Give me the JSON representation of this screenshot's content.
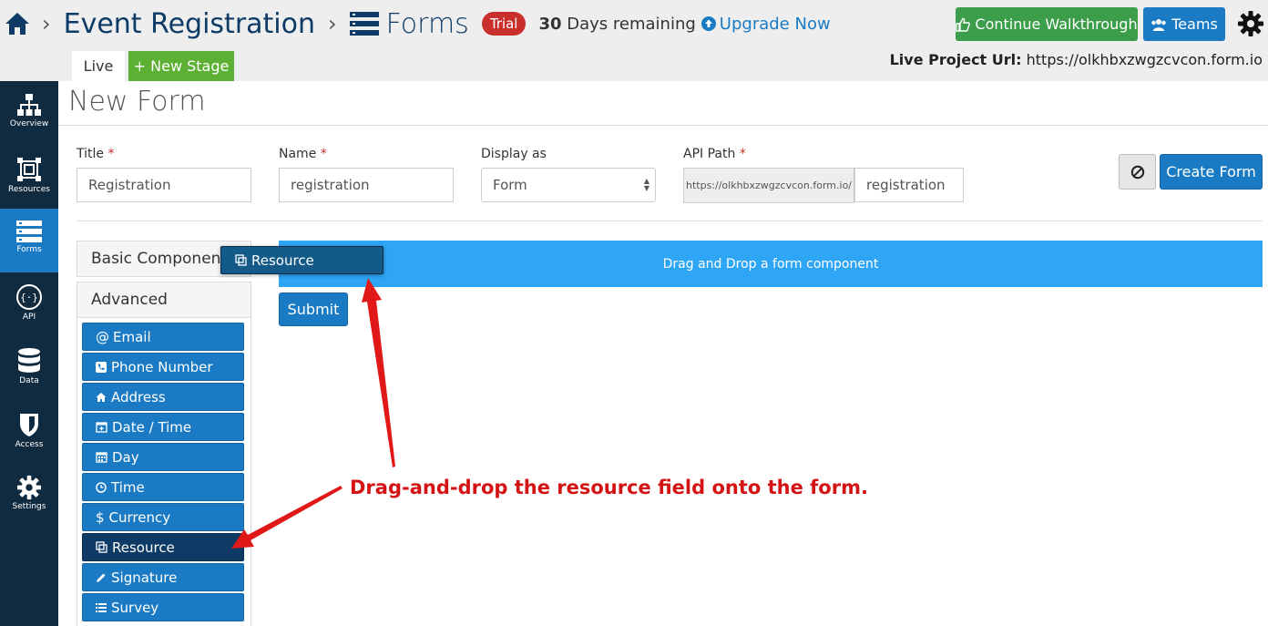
{
  "header": {
    "breadcrumb_project": "Event Registration",
    "breadcrumb_current": "Forms",
    "trial_badge": "Trial",
    "days_count": "30",
    "days_text": "Days remaining",
    "upgrade_label": "Upgrade Now",
    "walkthrough_label": "Continue Walkthrough",
    "teams_label": "Teams",
    "tab_live": "Live",
    "tab_new_stage": "+ New Stage",
    "live_url_label": "Live Project Url:",
    "live_url_value": "https://olkhbxzwgzcvcon.form.io"
  },
  "sidebar": {
    "items": [
      {
        "label": "Overview",
        "icon": "sitemap-icon"
      },
      {
        "label": "Resources",
        "icon": "resources-icon"
      },
      {
        "label": "Forms",
        "icon": "forms-icon",
        "active": true
      },
      {
        "label": "API",
        "icon": "api-icon"
      },
      {
        "label": "Data",
        "icon": "database-icon"
      },
      {
        "label": "Access",
        "icon": "shield-icon"
      },
      {
        "label": "Settings",
        "icon": "gear-icon"
      }
    ]
  },
  "page": {
    "title": "New Form",
    "fields": {
      "title_label": "Title",
      "title_value": "Registration",
      "name_label": "Name",
      "name_value": "registration",
      "display_label": "Display as",
      "display_value": "Form",
      "api_label": "API Path",
      "api_prefix": "https://olkhbxzwgzcvcon.form.io/",
      "api_value": "registration",
      "required_mark": "*"
    },
    "create_label": "Create Form"
  },
  "components": {
    "basic_heading": "Basic Components",
    "advanced_heading": "Advanced",
    "advanced_items": [
      {
        "label": "Email",
        "icon": "at-icon"
      },
      {
        "label": "Phone Number",
        "icon": "phone-icon"
      },
      {
        "label": "Address",
        "icon": "home-icon"
      },
      {
        "label": "Date / Time",
        "icon": "calendar-plus-icon"
      },
      {
        "label": "Day",
        "icon": "calendar-icon"
      },
      {
        "label": "Time",
        "icon": "clock-icon"
      },
      {
        "label": "Currency",
        "icon": "dollar-icon"
      },
      {
        "label": "Resource",
        "icon": "copy-icon",
        "dragging": true
      },
      {
        "label": "Signature",
        "icon": "pencil-icon"
      },
      {
        "label": "Survey",
        "icon": "list-icon"
      }
    ]
  },
  "builder": {
    "dropzone_text": "Drag and Drop a form component",
    "submit_label": "Submit",
    "drag_ghost_label": "Resource"
  },
  "annotation": {
    "text": "Drag-and-drop the resource field onto the form.",
    "color": "#d41414"
  },
  "colors": {
    "primary": "#1a7bc4",
    "sidebar": "#102b40",
    "success": "#5cb135",
    "danger": "#c9302c",
    "dropzone": "#2fa5f5"
  }
}
